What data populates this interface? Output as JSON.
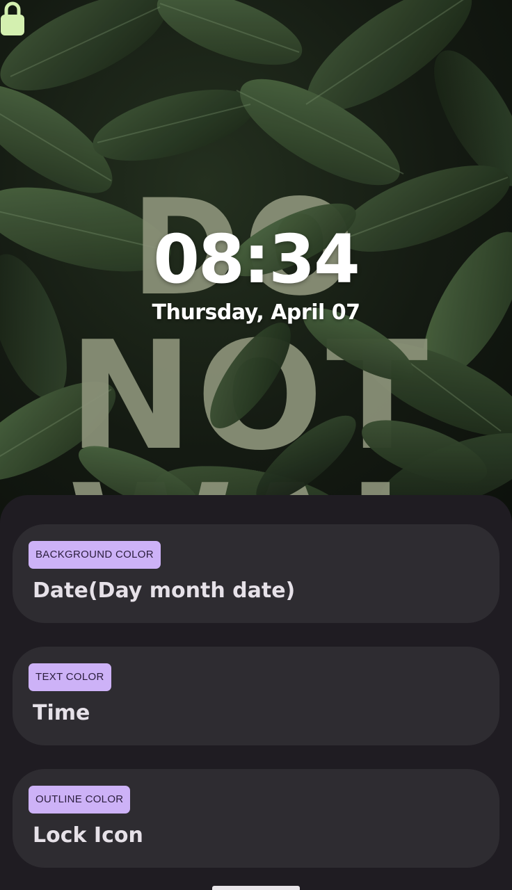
{
  "lock_preview": {
    "time": "08:34",
    "date": "Thursday, April 07",
    "lock_icon": "lock-icon",
    "lock_icon_color": "#d4f0b0",
    "wallpaper_text_line1": "DO",
    "wallpaper_text_line2": "NOT",
    "wallpaper_text_line3": "WAI",
    "wallpaper_text_color": "#8c937a"
  },
  "options": [
    {
      "badge": "BACKGROUND COLOR",
      "title": "Date(Day month date)"
    },
    {
      "badge": "TEXT COLOR",
      "title": "Time"
    },
    {
      "badge": "OUTLINE COLOR",
      "title": "Lock Icon"
    }
  ],
  "colors": {
    "sheet_background": "#1f1c22",
    "card_background": "#2e2c31",
    "badge_background": "#cdb2f7",
    "badge_text": "#2a1d3c",
    "card_title": "#e6e1e8"
  }
}
